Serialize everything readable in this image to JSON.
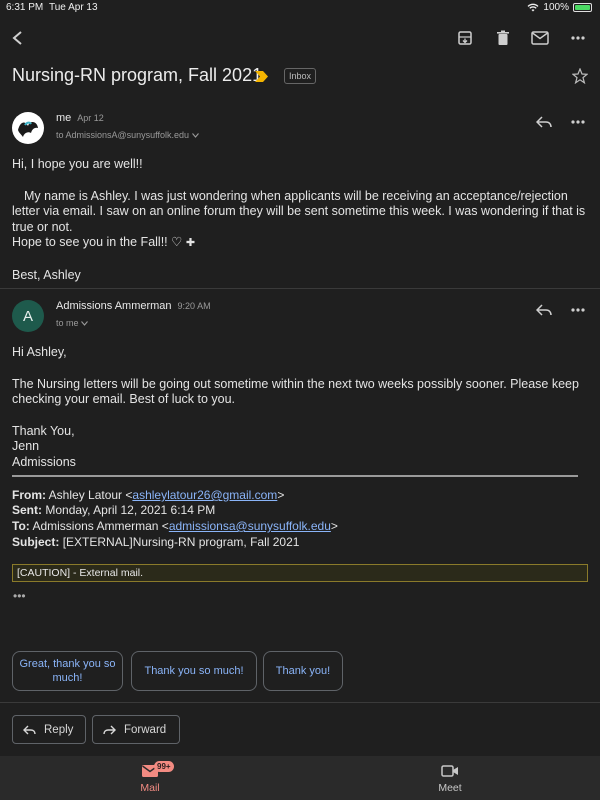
{
  "status_bar": {
    "time": "6:31 PM",
    "date": "Tue Apr 13",
    "battery": "100%"
  },
  "toolbar": {
    "back_icon": "arrow-back-icon",
    "archive_icon": "archive-icon",
    "delete_icon": "trash-icon",
    "mark_unread_icon": "mail-icon",
    "more_icon": "more-horizontal-icon"
  },
  "subject": {
    "title": "Nursing-RN program, Fall 2021",
    "label": "Inbox"
  },
  "messages": [
    {
      "sender": "me",
      "date": "Apr 12",
      "to": "to AdmissionsA@sunysuffolk.edu",
      "body": [
        "Hi, I hope you are well!!",
        "",
        "My name is Ashley. I was just wondering when applicants will be receiving an acceptance/rejection letter via email. I saw on an online forum they will be sent sometime this week. I was wondering if that is true or not.",
        "Hope to see you in the Fall!! ♡",
        "",
        "Best, Ashley"
      ]
    },
    {
      "sender": "Admissions Ammerman",
      "avatar_letter": "A",
      "date": "9:20 AM",
      "to": "to me",
      "body": [
        "Hi Ashley,",
        "The Nursing letters will be going out sometime within the next two weeks possibly sooner. Please keep checking your email. Best of luck to you.",
        "Thank You,",
        "Jenn",
        "Admissions"
      ],
      "quoted_header": {
        "from_label": "From:",
        "from_name": "Ashley Latour <",
        "from_email": "ashleylatour26@gmail.com",
        "from_close": ">",
        "sent_label": "Sent:",
        "sent": "Monday, April 12, 2021 6:14 PM",
        "to_label": "To:",
        "to_name": "Admissions Ammerman <",
        "to_email": "admissionsa@sunysuffolk.edu",
        "to_close": ">",
        "subject_label": "Subject:",
        "subject": "[EXTERNAL]Nursing-RN program, Fall 2021"
      },
      "caution": "[CAUTION] - External mail.",
      "ellipsis": "•••"
    }
  ],
  "smart_replies": [
    "Great, thank you so much!",
    "Thank you so much!",
    "Thank you!"
  ],
  "actions": {
    "reply": "Reply",
    "forward": "Forward"
  },
  "bottom_nav": {
    "mail": "Mail",
    "mail_badge": "99+",
    "meet": "Meet"
  },
  "colors": {
    "background": "#1f1f1f",
    "accent": "#8ab4f8",
    "mail_active": "#f28b82",
    "avatar_a": "#1e5a4c"
  }
}
